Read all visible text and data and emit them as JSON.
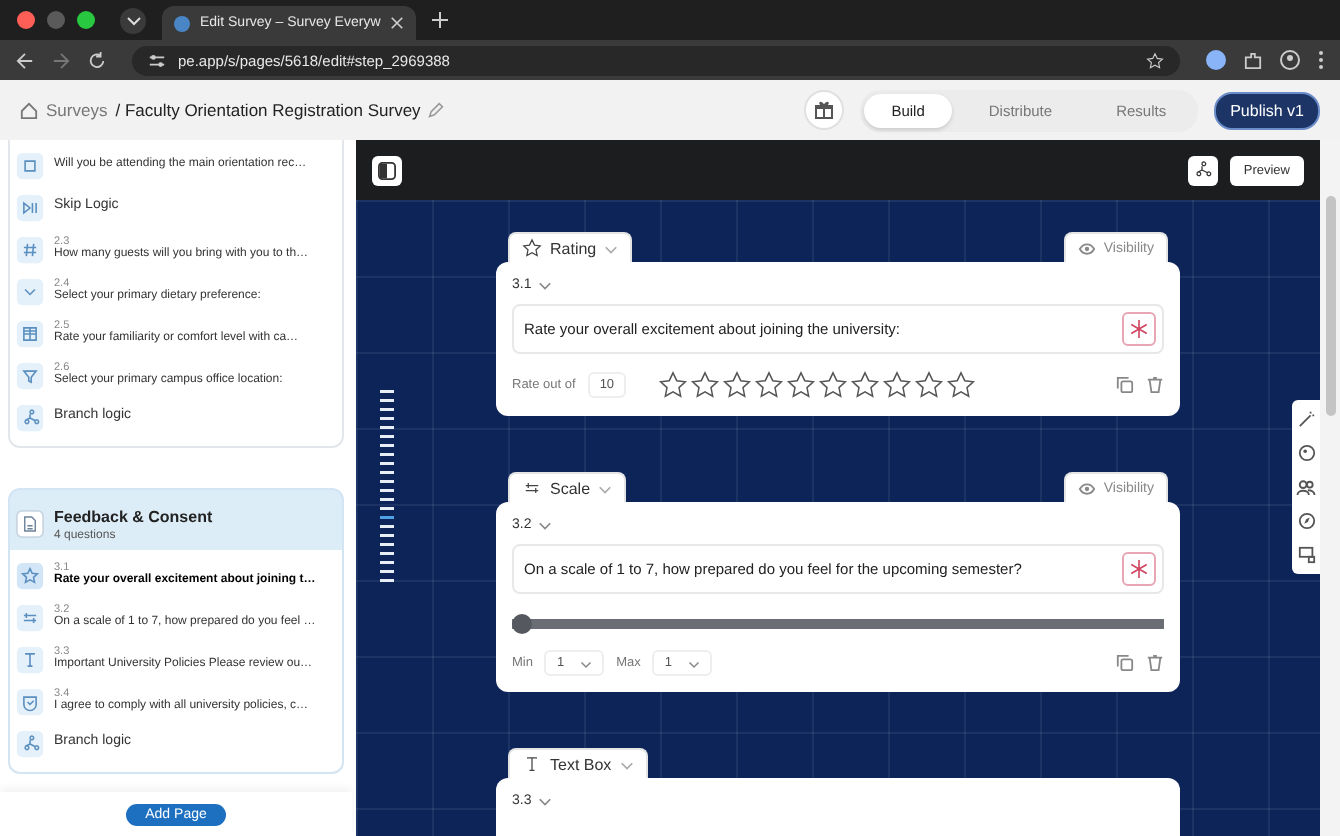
{
  "browser": {
    "tab_title": "Edit Survey – Survey Everyw",
    "url": "pe.app/s/pages/5618/edit#step_2969388"
  },
  "header": {
    "root": "Surveys",
    "title": "/ Faculty Orientation Registration Survey",
    "tabs": [
      {
        "label": "Build",
        "selected": true
      },
      {
        "label": "Distribute",
        "selected": false
      },
      {
        "label": "Results",
        "selected": false
      }
    ],
    "publish": "Publish v1"
  },
  "sidebar": {
    "pages": [
      {
        "items": [
          {
            "kind": "radio",
            "text": "Will you be attending the main orientation rec…",
            "selected": false
          },
          {
            "kind": "skip",
            "text": "Skip Logic",
            "selected": false
          },
          {
            "kind": "number",
            "number": "2.3",
            "text": "How many guests will you bring with you to th…",
            "selected": false
          },
          {
            "kind": "dropdown",
            "number": "2.4",
            "text": "Select your primary dietary preference:",
            "selected": false
          },
          {
            "kind": "grid",
            "number": "2.5",
            "text": "Rate your familiarity or comfort level with ca…",
            "selected": false
          },
          {
            "kind": "filter",
            "number": "2.6",
            "text": "Select your primary campus office location:",
            "selected": false
          },
          {
            "kind": "branch",
            "text": "Branch logic",
            "selected": false
          }
        ]
      },
      {
        "title": "Feedback & Consent",
        "count": "4 questions",
        "items": [
          {
            "kind": "star",
            "number": "3.1",
            "text": "Rate your overall excitement about joining t…",
            "selected": true
          },
          {
            "kind": "scale",
            "number": "3.2",
            "text": "On a scale of 1 to 7, how prepared do you feel …",
            "selected": false
          },
          {
            "kind": "text",
            "number": "3.3",
            "text": "Important University Policies Please review ou…",
            "selected": false
          },
          {
            "kind": "consent",
            "number": "3.4",
            "text": "I agree to comply with all university policies, c…",
            "selected": false
          },
          {
            "kind": "branch",
            "text": "Branch logic",
            "selected": false
          }
        ]
      }
    ],
    "add_page": "Add Page"
  },
  "canvas": {
    "preview": "Preview",
    "questions": [
      {
        "kind": "rating",
        "type_label": "Rating",
        "visibility": "Visibility",
        "number": "3.1",
        "text": "Rate your overall excitement about joining the university:",
        "required": true,
        "rate_label": "Rate out of",
        "rate_max": "10",
        "stars": 0
      },
      {
        "kind": "scale",
        "type_label": "Scale",
        "visibility": "Visibility",
        "number": "3.2",
        "text": "On a scale of 1 to 7, how prepared do you feel for the upcoming semester?",
        "required": true,
        "level": 0,
        "min_label": "Min",
        "min": "1",
        "max_label": "Max",
        "max": "1"
      },
      {
        "kind": "text",
        "type_label": "Text Box",
        "number": "3.3"
      }
    ]
  }
}
